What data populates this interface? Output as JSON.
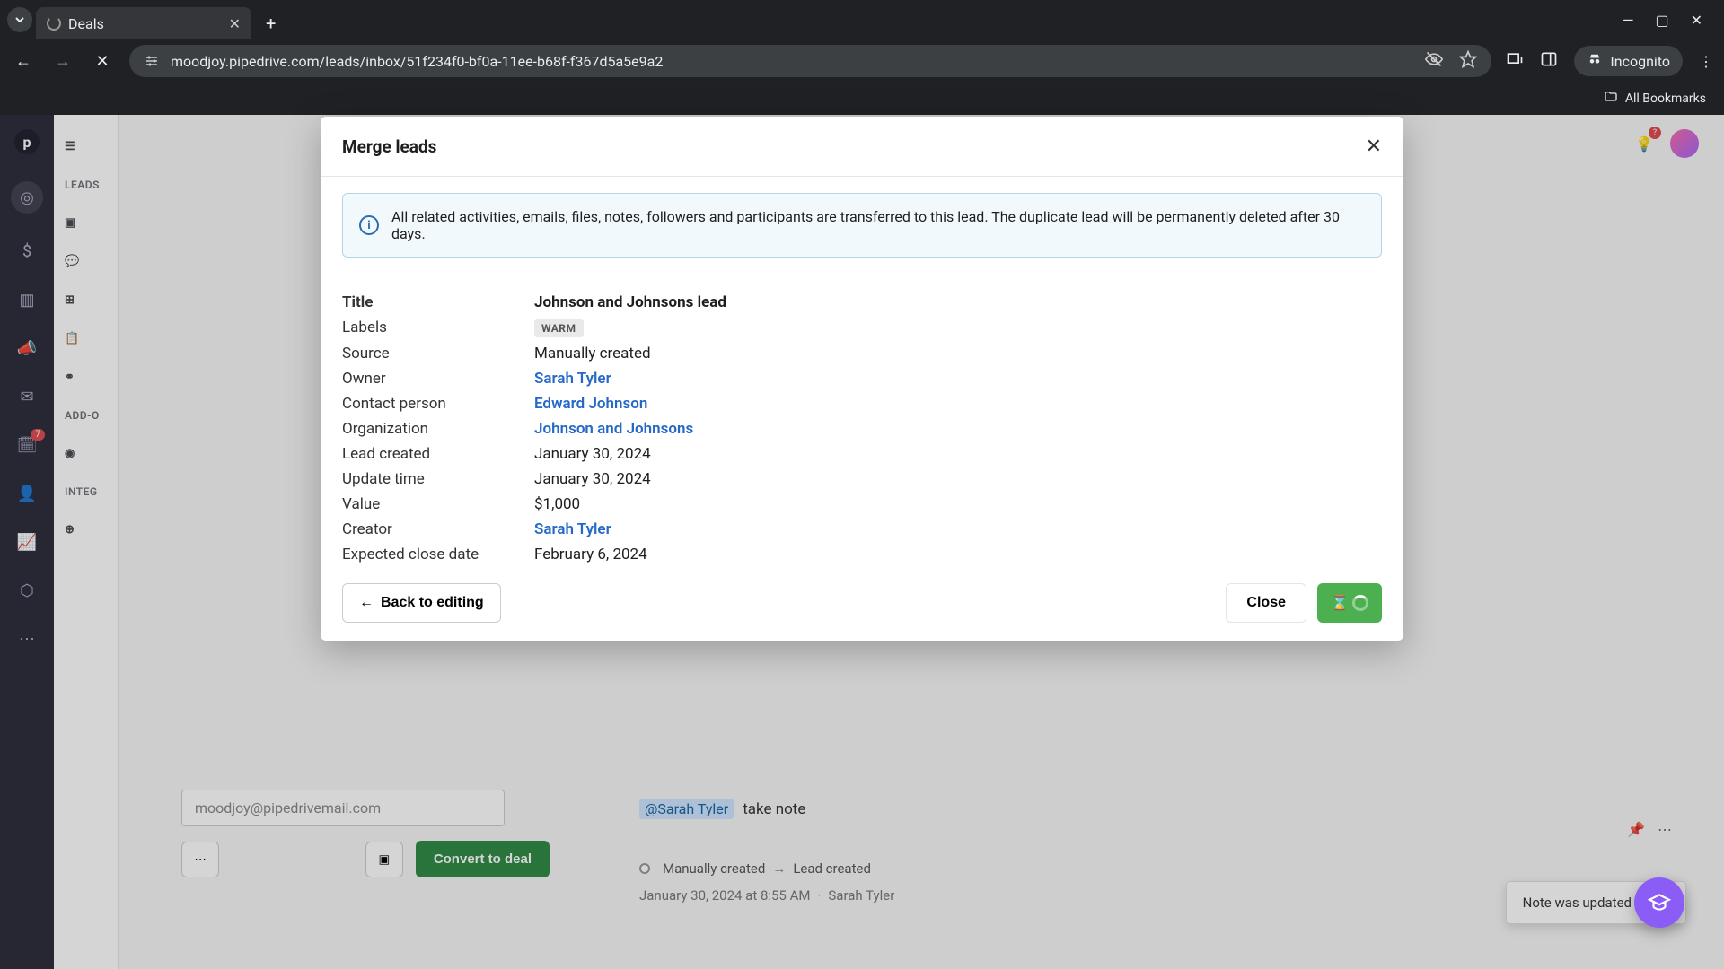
{
  "browser": {
    "tab_title": "Deals",
    "url": "moodjoy.pipedrive.com/leads/inbox/51f234f0-bf0a-11ee-b68f-f367d5a5e9a2",
    "incognito_label": "Incognito",
    "bookmarks_label": "All Bookmarks"
  },
  "sidebar": {
    "groups": [
      "LEADS",
      "ADD-O",
      "INTEG"
    ],
    "notification_count": "7",
    "help_badge": "?"
  },
  "modal": {
    "title": "Merge leads",
    "banner": "All related activities, emails, files, notes, followers and participants are transferred to this lead. The duplicate lead will be permanently deleted after 30 days.",
    "rows": {
      "title_label": "Title",
      "title_value": "Johnson and Johnsons lead",
      "labels_label": "Labels",
      "labels_value": "WARM",
      "source_label": "Source",
      "source_value": "Manually created",
      "owner_label": "Owner",
      "owner_value": "Sarah Tyler",
      "contact_label": "Contact person",
      "contact_value": "Edward Johnson",
      "org_label": "Organization",
      "org_value": "Johnson and Johnsons",
      "created_label": "Lead created",
      "created_value": "January 30, 2024",
      "updated_label": "Update time",
      "updated_value": "January 30, 2024",
      "value_label": "Value",
      "value_value": "$1,000",
      "creator_label": "Creator",
      "creator_value": "Sarah Tyler",
      "close_date_label": "Expected close date",
      "close_date_value": "February 6, 2024"
    },
    "back_button": "Back to editing",
    "close_button": "Close"
  },
  "behind": {
    "email_placeholder": "moodjoy@pipedrivemail.com",
    "convert_button": "Convert to deal",
    "mention": "@Sarah Tyler",
    "note_text": "take note",
    "event_source": "Manually created",
    "event_result": "Lead created",
    "event_time": "January 30, 2024 at 8:55 AM",
    "event_user": "Sarah Tyler"
  },
  "toast": {
    "message": "Note was updated"
  }
}
